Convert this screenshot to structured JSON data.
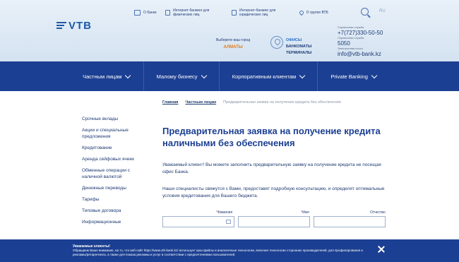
{
  "header": {
    "logo_text": "VTB",
    "top_links": [
      {
        "label": "О банке",
        "icon": "bank-icon"
      },
      {
        "label": "Интернет-банкинг для физических лиц",
        "icon": "card-icon"
      },
      {
        "label": "Интернет-банкинг для юридических лиц",
        "icon": "card-icon"
      },
      {
        "label": "О группе ВТБ",
        "icon": "pin-icon"
      }
    ],
    "language": "RU",
    "city_prompt": "Выберите ваш город",
    "city": "АЛМАТЫ",
    "offices": [
      "ОФИСЫ",
      "БАНКОМАТЫ",
      "ТЕРМИНАЛЫ"
    ],
    "contacts": [
      {
        "label": "Справочная служба",
        "value": "+7(727)330-50-50"
      },
      {
        "label": "Справочная служба",
        "value": "5050"
      },
      {
        "label": "Электронная почта",
        "value": "info@vtb-bank.kz"
      }
    ]
  },
  "nav": [
    "Частным лицам",
    "Малому бизнесу",
    "Корпоративным клиентам",
    "Private Banking"
  ],
  "sidebar": [
    "Срочные вклады",
    "Акции и специальные предложения",
    "Кредитование",
    "Аренда сейфовых ячеек",
    "Обменные операции с наличной валютой",
    "Денежные переводы",
    "Тарифы",
    "Типовые договора",
    "Информационные"
  ],
  "breadcrumb": {
    "home": "Главная",
    "section": "Частным лицам",
    "current": "Предварительная заявка на получение кредита без обеспечения"
  },
  "main": {
    "title": "Предварительная заявка на получение кредита наличными без обеспечения",
    "intro": "Уважаемый клиент! Вы можете заполнить предварительную заявку на получение кредита не посещая офис Банка.",
    "intro2": "Наши специалисты свяжутся с Вами, предоставят подробную консультацию, и определят оптимальные условия кредитования для Вашего бюджета."
  },
  "form": {
    "surname_label": "Фамилия",
    "name_label": "Имя",
    "patronymic_label": "Отчество",
    "required_mark": "*"
  },
  "cookie": {
    "title": "Уважаемые клиенты!",
    "text": "Обращаем Ваше внимание, на то, что веб-сайт https://www.vtb-bank.kz/ использует куки-файлы и аналогичные технологии, включая технологии сторонних производителей, для профилирования и рекламы/ретаргетинга, а также для показа рекламы и услуг в соответствии с предпочтениями пользователей."
  }
}
